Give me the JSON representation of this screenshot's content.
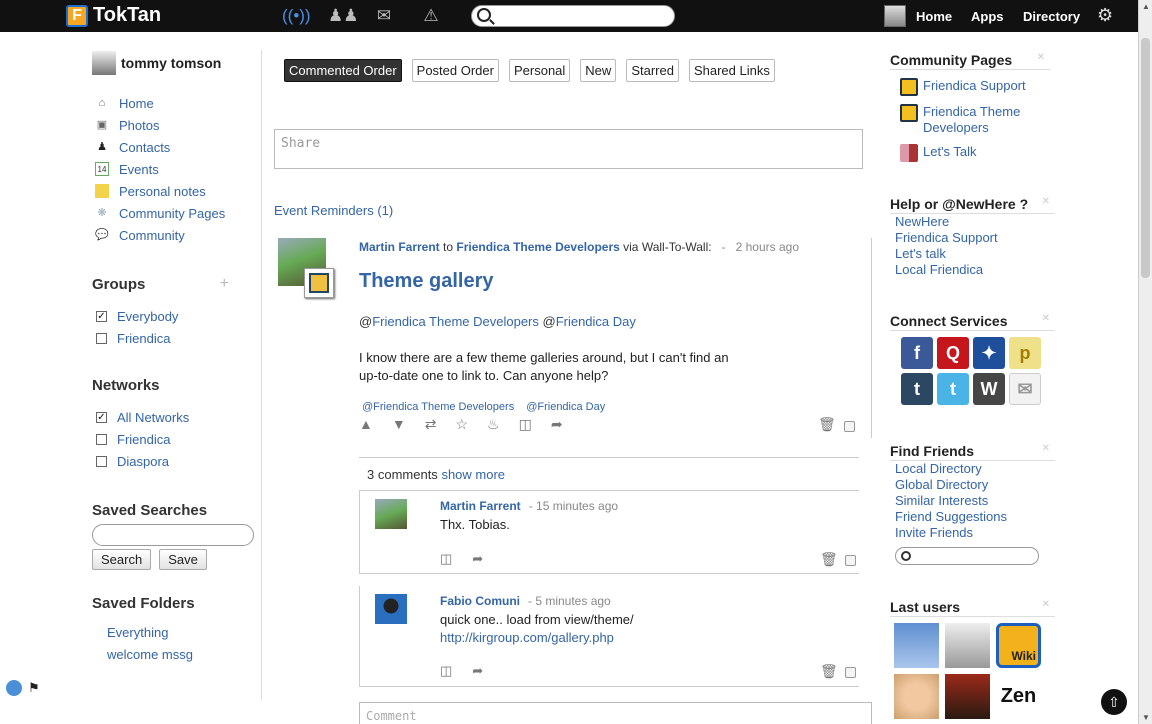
{
  "topbar": {
    "brand": "TokTan",
    "brand_letter": "F",
    "links": [
      "Home",
      "Apps",
      "Directory"
    ]
  },
  "profile": {
    "name": "tommy tomson"
  },
  "left_menu": [
    "Home",
    "Photos",
    "Contacts",
    "Events",
    "Personal notes",
    "Community Pages",
    "Community"
  ],
  "groups": {
    "title": "Groups",
    "items": [
      {
        "label": "Everybody",
        "checked": true
      },
      {
        "label": "Friendica",
        "checked": false
      }
    ]
  },
  "networks": {
    "title": "Networks",
    "items": [
      {
        "label": "All Networks",
        "checked": true
      },
      {
        "label": "Friendica",
        "checked": false
      },
      {
        "label": "Diaspora",
        "checked": false
      }
    ]
  },
  "saved_searches": {
    "title": "Saved Searches",
    "search_btn": "Search",
    "save_btn": "Save"
  },
  "saved_folders": {
    "title": "Saved Folders",
    "items": [
      "Everything",
      "welcome mssg"
    ]
  },
  "tabs": [
    "Commented Order",
    "Posted Order",
    "Personal",
    "New",
    "Starred",
    "Shared Links"
  ],
  "share_placeholder": "Share",
  "event_reminders": "Event Reminders (1)",
  "post": {
    "author": "Martin Farrent",
    "to_word": "to",
    "target": "Friendica Theme Developers",
    "via": "via Wall-To-Wall:",
    "sep": "-",
    "ago": "2 hours ago",
    "title": "Theme gallery",
    "mention1": "Friendica Theme Developers",
    "mention2": "Friendica Day",
    "body1": "I know there are a few theme galleries around, but I can't find an",
    "body2": "up-to-date one to link to. Can anyone help?",
    "tag1": "@Friendica Theme Developers",
    "tag2": "@Friendica Day"
  },
  "comments_head": {
    "count": "3 comments",
    "more": "show more"
  },
  "comments": [
    {
      "author": "Martin Farrent",
      "ago": "- 15 minutes ago",
      "line1": "Thx. Tobias.",
      "line2": ""
    },
    {
      "author": "Fabio Comuni",
      "ago": "- 5 minutes ago",
      "line1": "quick one.. load from view/theme/",
      "line2": "http://kirgroup.com/gallery.php"
    }
  ],
  "comment_placeholder": "Comment",
  "right": {
    "community_pages": {
      "title": "Community Pages",
      "items": [
        "Friendica Support",
        "Friendica Theme Developers",
        "Let's Talk"
      ]
    },
    "help": {
      "title": "Help or @NewHere ?",
      "items": [
        "NewHere",
        "Friendica Support",
        "Let's talk",
        "Local Friendica"
      ]
    },
    "connect": {
      "title": "Connect Services"
    },
    "find_friends": {
      "title": "Find Friends",
      "items": [
        "Local Directory",
        "Global Directory",
        "Similar Interests",
        "Friend Suggestions",
        "Invite Friends"
      ]
    },
    "last_users": {
      "title": "Last users",
      "tile_texts": [
        "Wiki",
        "Zen"
      ]
    }
  },
  "colors": {
    "link": "#3465a4",
    "topbar": "#111111"
  }
}
